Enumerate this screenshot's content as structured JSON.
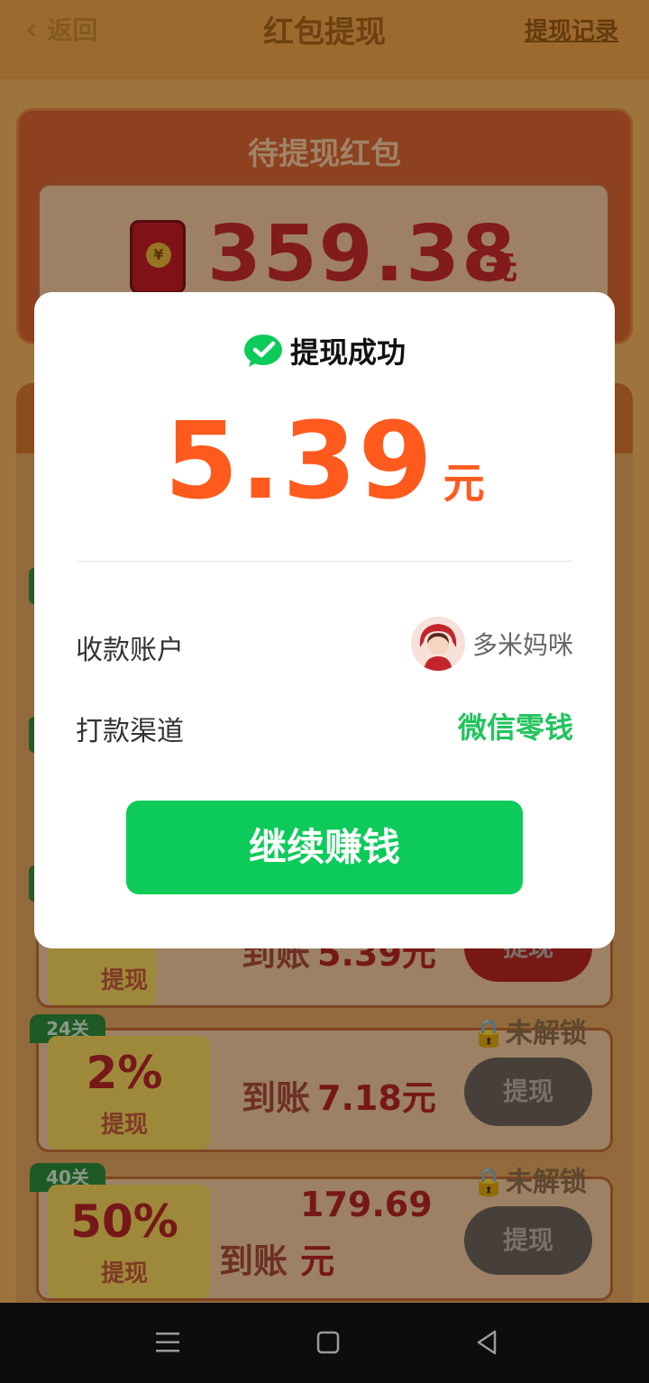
{
  "header": {
    "back_label": "返回",
    "title": "红包提现",
    "record_link": "提现记录"
  },
  "pending": {
    "title": "待提现红包",
    "amount": "359.38",
    "unit": "元"
  },
  "tiers": [
    {
      "level": "",
      "percent": "",
      "percent_label": "提现",
      "arrive_label": "到账",
      "amount": "5.39元",
      "button": "提现",
      "locked": false
    },
    {
      "level": "24关",
      "percent": "2%",
      "percent_label": "提现",
      "arrive_label": "到账",
      "amount": "7.18元",
      "button": "提现",
      "lock_text": "未解锁",
      "locked": true
    },
    {
      "level": "40关",
      "percent": "50%",
      "percent_label": "提现",
      "arrive_label": "到账",
      "amount": "179.69",
      "amount_unit": "元",
      "button": "提现",
      "lock_text": "未解锁",
      "locked": true
    }
  ],
  "modal": {
    "status_icon": "wechat-check-icon",
    "status_text": "提现成功",
    "amount": "5.39",
    "unit": "元",
    "account_label": "收款账户",
    "account_name": "多米妈咪",
    "channel_label": "打款渠道",
    "channel_value": "微信零钱",
    "cta_label": "继续赚钱"
  },
  "colors": {
    "amount_orange": "#ff5a1e",
    "wechat_green": "#0ccb5a",
    "channel_green": "#22c45d"
  },
  "navbar": {
    "icons": [
      "menu-icon",
      "home-square-icon",
      "back-triangle-icon"
    ]
  }
}
